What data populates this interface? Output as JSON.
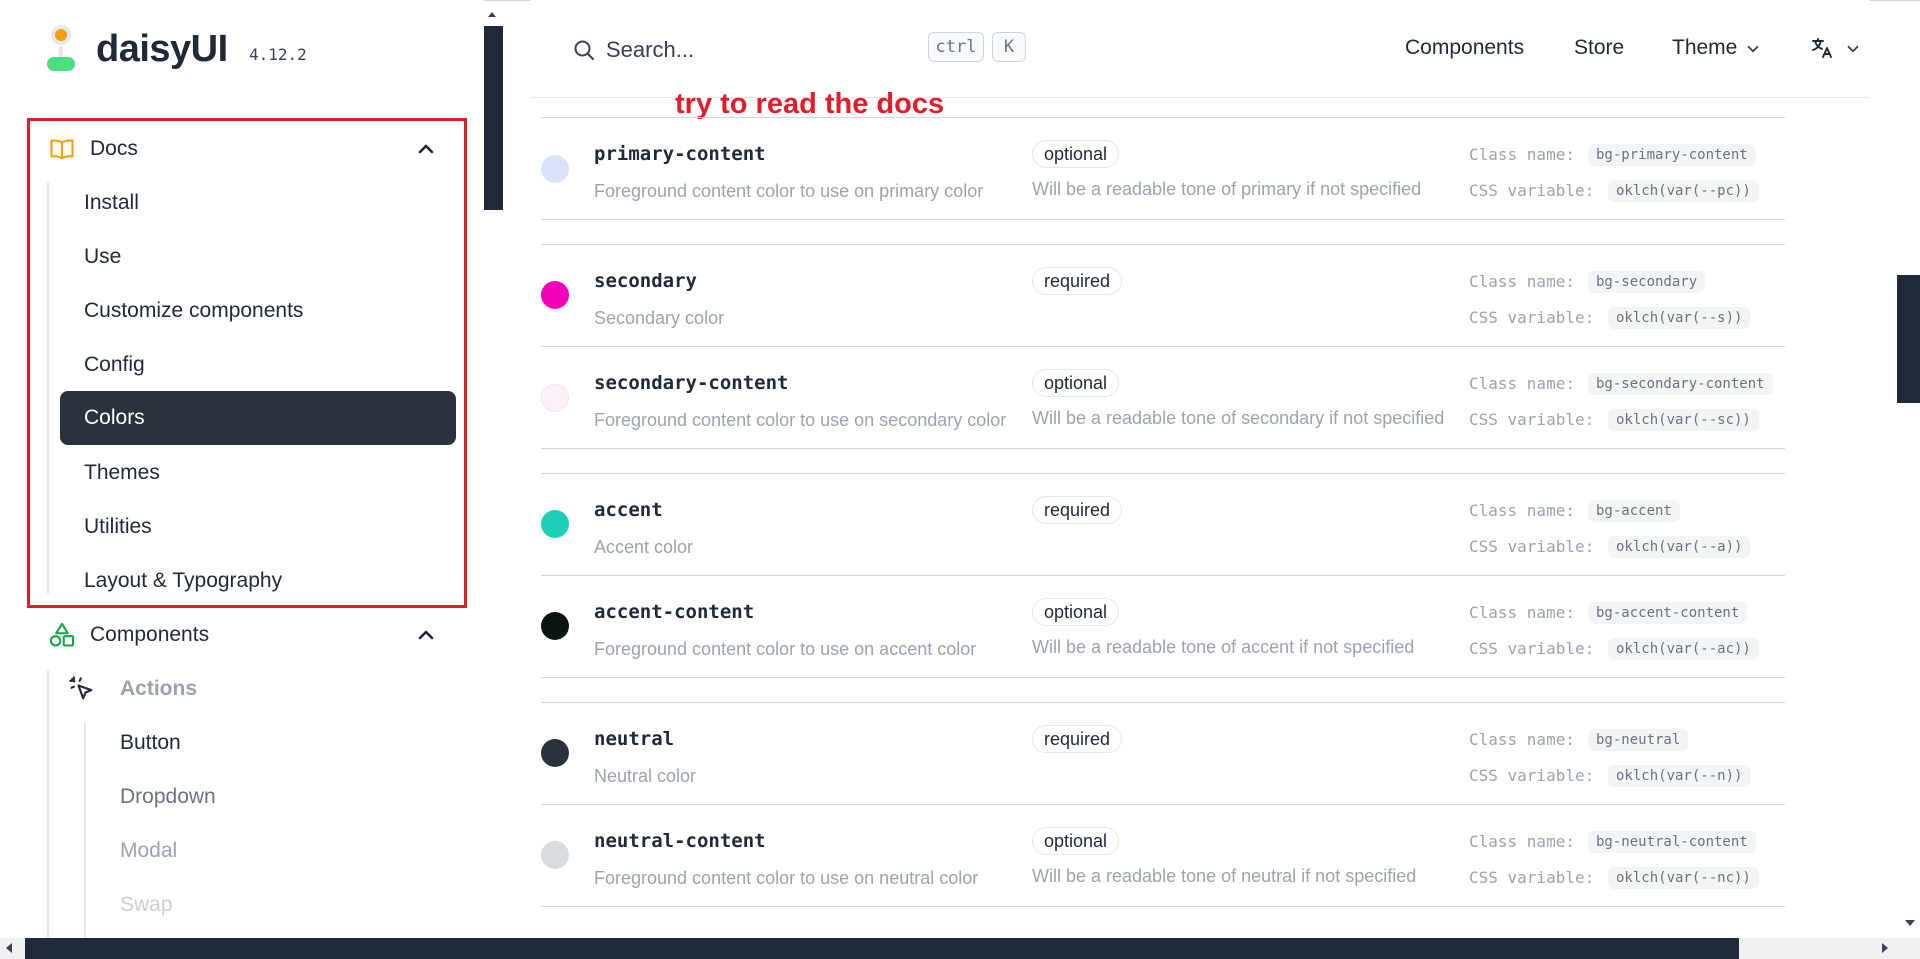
{
  "brand": {
    "name": "daisyUI",
    "version": "4.12.2"
  },
  "search": {
    "placeholder": "Search...",
    "shortcut_ctrl": "ctrl",
    "shortcut_key": "K"
  },
  "topnav": {
    "components": "Components",
    "store": "Store",
    "theme": "Theme"
  },
  "annotation": "try to read the docs",
  "sidebar": {
    "docs": {
      "label": "Docs",
      "items": [
        "Install",
        "Use",
        "Customize components",
        "Config",
        "Colors",
        "Themes",
        "Utilities",
        "Layout & Typography"
      ],
      "active": "Colors"
    },
    "components": {
      "label": "Components",
      "group": "Actions",
      "items": [
        "Button",
        "Dropdown",
        "Modal",
        "Swap"
      ]
    }
  },
  "colors": {
    "class_label": "Class name:",
    "var_label": "CSS variable:",
    "rows": [
      {
        "name": "primary-content",
        "desc": "Foreground content color to use on primary color",
        "badge": "optional",
        "note": "Will be a readable tone of primary if not specified",
        "class": "bg-primary-content",
        "var": "oklch(var(--pc))",
        "swatch": "#dbe3fb"
      },
      {
        "name": "secondary",
        "desc": "Secondary color",
        "badge": "required",
        "note": "",
        "class": "bg-secondary",
        "var": "oklch(var(--s))",
        "swatch": "#f000b8"
      },
      {
        "name": "secondary-content",
        "desc": "Foreground content color to use on secondary color",
        "badge": "optional",
        "note": "Will be a readable tone of secondary if not specified",
        "class": "bg-secondary-content",
        "var": "oklch(var(--sc))",
        "swatch": "#fdf2fa"
      },
      {
        "name": "accent",
        "desc": "Accent color",
        "badge": "required",
        "note": "",
        "class": "bg-accent",
        "var": "oklch(var(--a))",
        "swatch": "#1ccfb5"
      },
      {
        "name": "accent-content",
        "desc": "Foreground content color to use on accent color",
        "badge": "optional",
        "note": "Will be a readable tone of accent if not specified",
        "class": "bg-accent-content",
        "var": "oklch(var(--ac))",
        "swatch": "#0b1410"
      },
      {
        "name": "neutral",
        "desc": "Neutral color",
        "badge": "required",
        "note": "",
        "class": "bg-neutral",
        "var": "oklch(var(--n))",
        "swatch": "#2a323c"
      },
      {
        "name": "neutral-content",
        "desc": "Foreground content color to use on neutral color",
        "badge": "optional",
        "note": "Will be a readable tone of neutral if not specified",
        "class": "bg-neutral-content",
        "var": "oklch(var(--nc))",
        "swatch": "#d8dbdf"
      }
    ]
  },
  "theme_colors": {
    "accent_orange": "#f59e0b",
    "highlight_red": "#e11d2a",
    "active_bg": "#2a323c",
    "success_green": "#16a34a"
  }
}
